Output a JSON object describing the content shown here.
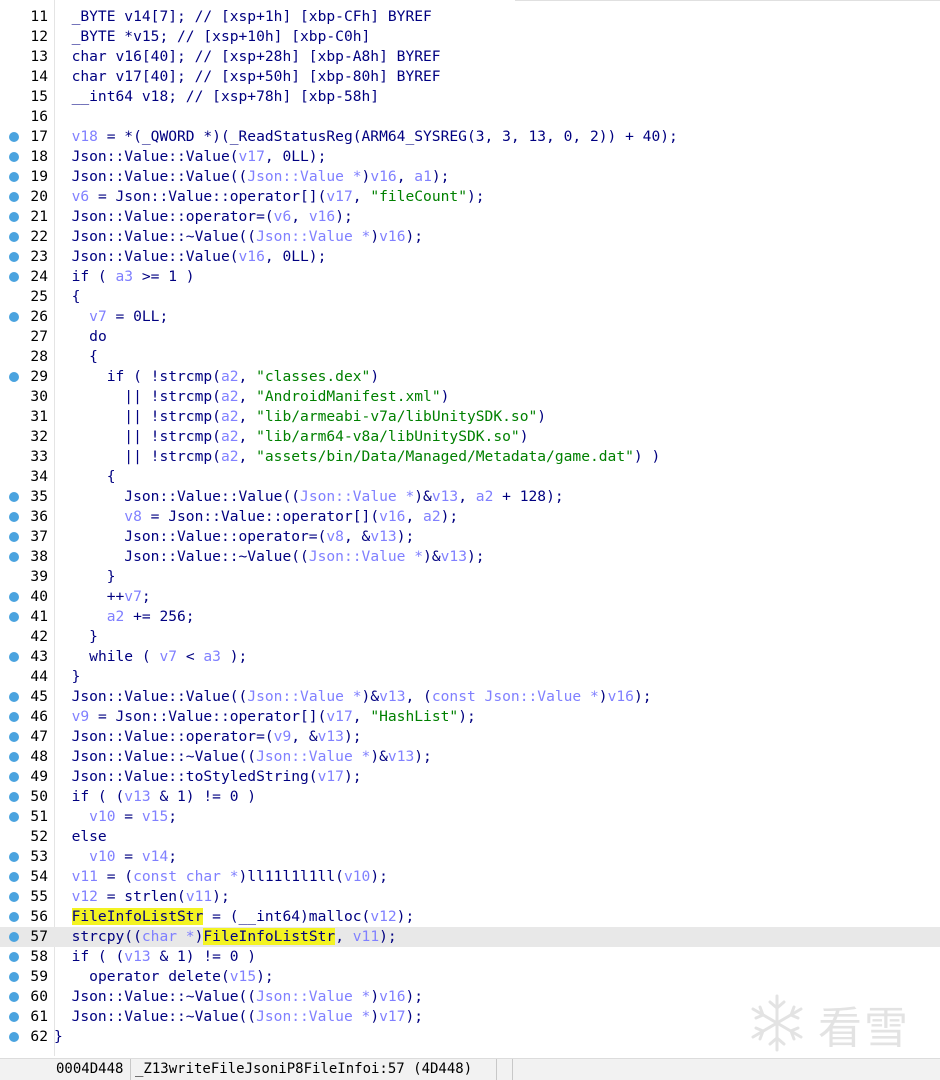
{
  "editor": {
    "lines": [
      {
        "num": "11",
        "bp": false,
        "indent": "  ",
        "tokens": [
          [
            "t",
            "_BYTE v14[7]; // [xsp+1h] [xbp-CFh] BYREF"
          ]
        ]
      },
      {
        "num": "12",
        "bp": false,
        "indent": "  ",
        "tokens": [
          [
            "t",
            "_BYTE *v15; // [xsp+10h] [xbp-C0h]"
          ]
        ]
      },
      {
        "num": "13",
        "bp": false,
        "indent": "  ",
        "tokens": [
          [
            "t",
            "char v16[40]; // [xsp+28h] [xbp-A8h] BYREF"
          ]
        ]
      },
      {
        "num": "14",
        "bp": false,
        "indent": "  ",
        "tokens": [
          [
            "t",
            "char v17[40]; // [xsp+50h] [xbp-80h] BYREF"
          ]
        ]
      },
      {
        "num": "15",
        "bp": false,
        "indent": "  ",
        "tokens": [
          [
            "t",
            "__int64 v18; // [xsp+78h] [xbp-58h]"
          ]
        ]
      },
      {
        "num": "16",
        "bp": false,
        "indent": "",
        "tokens": []
      },
      {
        "num": "17",
        "bp": true,
        "indent": "  ",
        "tokens": [
          [
            "v",
            "v18"
          ],
          [
            "t",
            " = *(_QWORD *)(_ReadStatusReg(ARM64_SYSREG(3, 3, 13, 0, 2)) + 40);"
          ]
        ]
      },
      {
        "num": "18",
        "bp": true,
        "indent": "  ",
        "tokens": [
          [
            "t",
            "Json::Value::Value("
          ],
          [
            "v",
            "v17"
          ],
          [
            "t",
            ", 0LL);"
          ]
        ]
      },
      {
        "num": "19",
        "bp": true,
        "indent": "  ",
        "tokens": [
          [
            "t",
            "Json::Value::Value(("
          ],
          [
            "v",
            "Json::Value *"
          ],
          [
            "t",
            ")"
          ],
          [
            "v",
            "v16"
          ],
          [
            "t",
            ", "
          ],
          [
            "v",
            "a1"
          ],
          [
            "t",
            ");"
          ]
        ]
      },
      {
        "num": "20",
        "bp": true,
        "indent": "  ",
        "tokens": [
          [
            "v",
            "v6"
          ],
          [
            "t",
            " = Json::Value::operator[]("
          ],
          [
            "v",
            "v17"
          ],
          [
            "t",
            ", "
          ],
          [
            "s",
            "\"fileCount\""
          ],
          [
            "t",
            ");"
          ]
        ]
      },
      {
        "num": "21",
        "bp": true,
        "indent": "  ",
        "tokens": [
          [
            "t",
            "Json::Value::operator=("
          ],
          [
            "v",
            "v6"
          ],
          [
            "t",
            ", "
          ],
          [
            "v",
            "v16"
          ],
          [
            "t",
            ");"
          ]
        ]
      },
      {
        "num": "22",
        "bp": true,
        "indent": "  ",
        "tokens": [
          [
            "t",
            "Json::Value::~Value(("
          ],
          [
            "v",
            "Json::Value *"
          ],
          [
            "t",
            ")"
          ],
          [
            "v",
            "v16"
          ],
          [
            "t",
            ");"
          ]
        ]
      },
      {
        "num": "23",
        "bp": true,
        "indent": "  ",
        "tokens": [
          [
            "t",
            "Json::Value::Value("
          ],
          [
            "v",
            "v16"
          ],
          [
            "t",
            ", 0LL);"
          ]
        ]
      },
      {
        "num": "24",
        "bp": true,
        "indent": "  ",
        "tokens": [
          [
            "t",
            "if ( "
          ],
          [
            "v",
            "a3"
          ],
          [
            "t",
            " >= 1 )"
          ]
        ]
      },
      {
        "num": "25",
        "bp": false,
        "indent": "  ",
        "tokens": [
          [
            "t",
            "{"
          ]
        ]
      },
      {
        "num": "26",
        "bp": true,
        "indent": "    ",
        "tokens": [
          [
            "v",
            "v7"
          ],
          [
            "t",
            " = 0LL;"
          ]
        ]
      },
      {
        "num": "27",
        "bp": false,
        "indent": "    ",
        "tokens": [
          [
            "t",
            "do"
          ]
        ]
      },
      {
        "num": "28",
        "bp": false,
        "indent": "    ",
        "tokens": [
          [
            "t",
            "{"
          ]
        ]
      },
      {
        "num": "29",
        "bp": true,
        "indent": "      ",
        "tokens": [
          [
            "t",
            "if ( !strcmp("
          ],
          [
            "v",
            "a2"
          ],
          [
            "t",
            ", "
          ],
          [
            "s",
            "\"classes.dex\""
          ],
          [
            "t",
            ")"
          ]
        ]
      },
      {
        "num": "30",
        "bp": false,
        "indent": "        ",
        "tokens": [
          [
            "t",
            "|| !strcmp("
          ],
          [
            "v",
            "a2"
          ],
          [
            "t",
            ", "
          ],
          [
            "s",
            "\"AndroidManifest.xml\""
          ],
          [
            "t",
            ")"
          ]
        ]
      },
      {
        "num": "31",
        "bp": false,
        "indent": "        ",
        "tokens": [
          [
            "t",
            "|| !strcmp("
          ],
          [
            "v",
            "a2"
          ],
          [
            "t",
            ", "
          ],
          [
            "s",
            "\"lib/armeabi-v7a/libUnitySDK.so\""
          ],
          [
            "t",
            ")"
          ]
        ]
      },
      {
        "num": "32",
        "bp": false,
        "indent": "        ",
        "tokens": [
          [
            "t",
            "|| !strcmp("
          ],
          [
            "v",
            "a2"
          ],
          [
            "t",
            ", "
          ],
          [
            "s",
            "\"lib/arm64-v8a/libUnitySDK.so\""
          ],
          [
            "t",
            ")"
          ]
        ]
      },
      {
        "num": "33",
        "bp": false,
        "indent": "        ",
        "tokens": [
          [
            "t",
            "|| !strcmp("
          ],
          [
            "v",
            "a2"
          ],
          [
            "t",
            ", "
          ],
          [
            "s",
            "\"assets/bin/Data/Managed/Metadata/game.dat\""
          ],
          [
            "t",
            ") )"
          ]
        ]
      },
      {
        "num": "34",
        "bp": false,
        "indent": "      ",
        "tokens": [
          [
            "t",
            "{"
          ]
        ]
      },
      {
        "num": "35",
        "bp": true,
        "indent": "        ",
        "tokens": [
          [
            "t",
            "Json::Value::Value(("
          ],
          [
            "v",
            "Json::Value *"
          ],
          [
            "t",
            ")&"
          ],
          [
            "v",
            "v13"
          ],
          [
            "t",
            ", "
          ],
          [
            "v",
            "a2"
          ],
          [
            "t",
            " + 128);"
          ]
        ]
      },
      {
        "num": "36",
        "bp": true,
        "indent": "        ",
        "tokens": [
          [
            "v",
            "v8"
          ],
          [
            "t",
            " = Json::Value::operator[]("
          ],
          [
            "v",
            "v16"
          ],
          [
            "t",
            ", "
          ],
          [
            "v",
            "a2"
          ],
          [
            "t",
            ");"
          ]
        ]
      },
      {
        "num": "37",
        "bp": true,
        "indent": "        ",
        "tokens": [
          [
            "t",
            "Json::Value::operator=("
          ],
          [
            "v",
            "v8"
          ],
          [
            "t",
            ", &"
          ],
          [
            "v",
            "v13"
          ],
          [
            "t",
            ");"
          ]
        ]
      },
      {
        "num": "38",
        "bp": true,
        "indent": "        ",
        "tokens": [
          [
            "t",
            "Json::Value::~Value(("
          ],
          [
            "v",
            "Json::Value *"
          ],
          [
            "t",
            ")&"
          ],
          [
            "v",
            "v13"
          ],
          [
            "t",
            ");"
          ]
        ]
      },
      {
        "num": "39",
        "bp": false,
        "indent": "      ",
        "tokens": [
          [
            "t",
            "}"
          ]
        ]
      },
      {
        "num": "40",
        "bp": true,
        "indent": "      ",
        "tokens": [
          [
            "t",
            "++"
          ],
          [
            "v",
            "v7"
          ],
          [
            "t",
            ";"
          ]
        ]
      },
      {
        "num": "41",
        "bp": true,
        "indent": "      ",
        "tokens": [
          [
            "v",
            "a2"
          ],
          [
            "t",
            " += 256;"
          ]
        ]
      },
      {
        "num": "42",
        "bp": false,
        "indent": "    ",
        "tokens": [
          [
            "t",
            "}"
          ]
        ]
      },
      {
        "num": "43",
        "bp": true,
        "indent": "    ",
        "tokens": [
          [
            "t",
            "while ( "
          ],
          [
            "v",
            "v7"
          ],
          [
            "t",
            " < "
          ],
          [
            "v",
            "a3"
          ],
          [
            "t",
            " );"
          ]
        ]
      },
      {
        "num": "44",
        "bp": false,
        "indent": "  ",
        "tokens": [
          [
            "t",
            "}"
          ]
        ]
      },
      {
        "num": "45",
        "bp": true,
        "indent": "  ",
        "tokens": [
          [
            "t",
            "Json::Value::Value(("
          ],
          [
            "v",
            "Json::Value *"
          ],
          [
            "t",
            ")&"
          ],
          [
            "v",
            "v13"
          ],
          [
            "t",
            ", ("
          ],
          [
            "v",
            "const Json::Value *"
          ],
          [
            "t",
            ")"
          ],
          [
            "v",
            "v16"
          ],
          [
            "t",
            ");"
          ]
        ]
      },
      {
        "num": "46",
        "bp": true,
        "indent": "  ",
        "tokens": [
          [
            "v",
            "v9"
          ],
          [
            "t",
            " = Json::Value::operator[]("
          ],
          [
            "v",
            "v17"
          ],
          [
            "t",
            ", "
          ],
          [
            "s",
            "\"HashList\""
          ],
          [
            "t",
            ");"
          ]
        ]
      },
      {
        "num": "47",
        "bp": true,
        "indent": "  ",
        "tokens": [
          [
            "t",
            "Json::Value::operator=("
          ],
          [
            "v",
            "v9"
          ],
          [
            "t",
            ", &"
          ],
          [
            "v",
            "v13"
          ],
          [
            "t",
            ");"
          ]
        ]
      },
      {
        "num": "48",
        "bp": true,
        "indent": "  ",
        "tokens": [
          [
            "t",
            "Json::Value::~Value(("
          ],
          [
            "v",
            "Json::Value *"
          ],
          [
            "t",
            ")&"
          ],
          [
            "v",
            "v13"
          ],
          [
            "t",
            ");"
          ]
        ]
      },
      {
        "num": "49",
        "bp": true,
        "indent": "  ",
        "tokens": [
          [
            "t",
            "Json::Value::toStyledString("
          ],
          [
            "v",
            "v17"
          ],
          [
            "t",
            ");"
          ]
        ]
      },
      {
        "num": "50",
        "bp": true,
        "indent": "  ",
        "tokens": [
          [
            "t",
            "if ( ("
          ],
          [
            "v",
            "v13"
          ],
          [
            "t",
            " & 1) != 0 )"
          ]
        ]
      },
      {
        "num": "51",
        "bp": true,
        "indent": "    ",
        "tokens": [
          [
            "v",
            "v10"
          ],
          [
            "t",
            " = "
          ],
          [
            "v",
            "v15"
          ],
          [
            "t",
            ";"
          ]
        ]
      },
      {
        "num": "52",
        "bp": false,
        "indent": "  ",
        "tokens": [
          [
            "t",
            "else"
          ]
        ]
      },
      {
        "num": "53",
        "bp": true,
        "indent": "    ",
        "tokens": [
          [
            "v",
            "v10"
          ],
          [
            "t",
            " = "
          ],
          [
            "v",
            "v14"
          ],
          [
            "t",
            ";"
          ]
        ]
      },
      {
        "num": "54",
        "bp": true,
        "indent": "  ",
        "tokens": [
          [
            "v",
            "v11"
          ],
          [
            "t",
            " = ("
          ],
          [
            "v",
            "const char *"
          ],
          [
            "t",
            ")ll11l1l1ll("
          ],
          [
            "v",
            "v10"
          ],
          [
            "t",
            ");"
          ]
        ]
      },
      {
        "num": "55",
        "bp": true,
        "indent": "  ",
        "tokens": [
          [
            "v",
            "v12"
          ],
          [
            "t",
            " = strlen("
          ],
          [
            "v",
            "v11"
          ],
          [
            "t",
            ");"
          ]
        ]
      },
      {
        "num": "56",
        "bp": true,
        "indent": "  ",
        "tokens": [
          [
            "h",
            "FileInfoListStr"
          ],
          [
            "t",
            " = (__int64)malloc("
          ],
          [
            "v",
            "v12"
          ],
          [
            "t",
            ");"
          ]
        ]
      },
      {
        "num": "57",
        "bp": true,
        "indent": "  ",
        "current": true,
        "tokens": [
          [
            "t",
            "strcpy(("
          ],
          [
            "v",
            "char *"
          ],
          [
            "t",
            ")"
          ],
          [
            "h",
            "FileInfoListStr"
          ],
          [
            "t",
            ", "
          ],
          [
            "v",
            "v11"
          ],
          [
            "t",
            ");"
          ]
        ]
      },
      {
        "num": "58",
        "bp": true,
        "indent": "  ",
        "tokens": [
          [
            "t",
            "if ( ("
          ],
          [
            "v",
            "v13"
          ],
          [
            "t",
            " & 1) != 0 )"
          ]
        ]
      },
      {
        "num": "59",
        "bp": true,
        "indent": "    ",
        "tokens": [
          [
            "t",
            "operator delete("
          ],
          [
            "v",
            "v15"
          ],
          [
            "t",
            ");"
          ]
        ]
      },
      {
        "num": "60",
        "bp": true,
        "indent": "  ",
        "tokens": [
          [
            "t",
            "Json::Value::~Value(("
          ],
          [
            "v",
            "Json::Value *"
          ],
          [
            "t",
            ")"
          ],
          [
            "v",
            "v16"
          ],
          [
            "t",
            ");"
          ]
        ]
      },
      {
        "num": "61",
        "bp": true,
        "indent": "  ",
        "tokens": [
          [
            "t",
            "Json::Value::~Value(("
          ],
          [
            "v",
            "Json::Value *"
          ],
          [
            "t",
            ")"
          ],
          [
            "v",
            "v17"
          ],
          [
            "t",
            ");"
          ]
        ]
      },
      {
        "num": "62",
        "bp": true,
        "indent": "",
        "tokens": [
          [
            "t",
            "}"
          ]
        ]
      }
    ]
  },
  "status": {
    "address": "0004D448",
    "location": "_Z13writeFileJsoniP8FileInfoi:57 (4D448)"
  },
  "watermark": {
    "text": "看雪",
    "icon": "snowflake-icon"
  },
  "colors": {
    "code_text": "#000080",
    "variable": "#8080ff",
    "string": "#008000",
    "highlight": "#f3f322",
    "breakpoint": "#4aa3df",
    "current_line": "#e8e8e8"
  }
}
